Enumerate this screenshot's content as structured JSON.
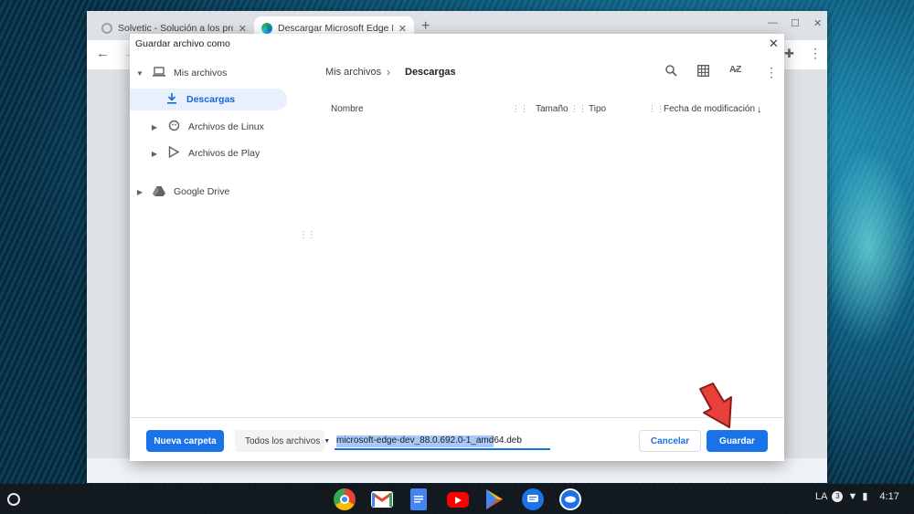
{
  "browser": {
    "tabs": [
      {
        "title": "Solvetic - Solución a los problem",
        "active": false
      },
      {
        "title": "Descargar Microsoft Edge Inside",
        "active": true
      }
    ],
    "new_tab_icon": "plus-icon"
  },
  "dialog": {
    "title": "Guardar archivo como",
    "nav": {
      "root": "Mis archivos",
      "items": [
        {
          "label": "Descargas",
          "icon": "download-icon",
          "selected": true
        },
        {
          "label": "Archivos de Linux",
          "icon": "linux-icon",
          "selected": false
        },
        {
          "label": "Archivos de Play",
          "icon": "play-icon",
          "selected": false
        }
      ],
      "drive": "Google Drive"
    },
    "breadcrumb": {
      "root": "Mis archivos",
      "current": "Descargas"
    },
    "columns": {
      "name": "Nombre",
      "size": "Tamaño",
      "type": "Tipo",
      "modified": "Fecha de modificación"
    },
    "footer": {
      "new_folder": "Nueva carpeta",
      "filter": "Todos los archivos",
      "filename": "microsoft-edge-dev_88.0.692.0-1_amd64.deb",
      "cancel": "Cancelar",
      "save": "Guardar"
    }
  },
  "shelf": {
    "apps": [
      "chrome-icon",
      "gmail-icon",
      "docs-icon",
      "youtube-icon",
      "play-store-icon",
      "messages-icon",
      "app-icon"
    ],
    "ime": "LA",
    "notifications": "3",
    "time": "4:17"
  },
  "colors": {
    "accent": "#1a73e8",
    "selected_bg": "#e8f0fe",
    "annotation_arrow": "#e8403a"
  }
}
